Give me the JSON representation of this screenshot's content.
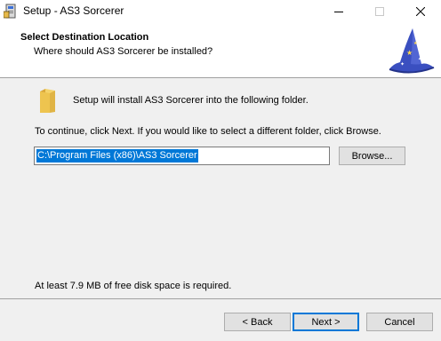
{
  "window": {
    "title": "Setup - AS3 Sorcerer",
    "icons": {
      "app": "setup-icon",
      "minimize": "minimize-icon",
      "maximize": "maximize-icon",
      "close": "close-icon"
    }
  },
  "header": {
    "title": "Select Destination Location",
    "subtitle": "Where should AS3 Sorcerer be installed?",
    "image": "wizard-hat-image"
  },
  "body": {
    "folder_icon": "folder-icon",
    "intro": "Setup will install AS3 Sorcerer into the following folder.",
    "instruction": "To continue, click Next. If you would like to select a different folder, click Browse.",
    "path_value": "C:\\Program Files (x86)\\AS3 Sorcerer",
    "browse_label": "Browse...",
    "space_required": "At least 7.9 MB of free disk space is required."
  },
  "footer": {
    "back_label": "< Back",
    "next_label": "Next >",
    "cancel_label": "Cancel"
  },
  "colors": {
    "selection": "#0078d7",
    "default_button_border": "#0078d7",
    "body_background": "#f0f0f0",
    "hat_blue": "#3a4fc0"
  }
}
